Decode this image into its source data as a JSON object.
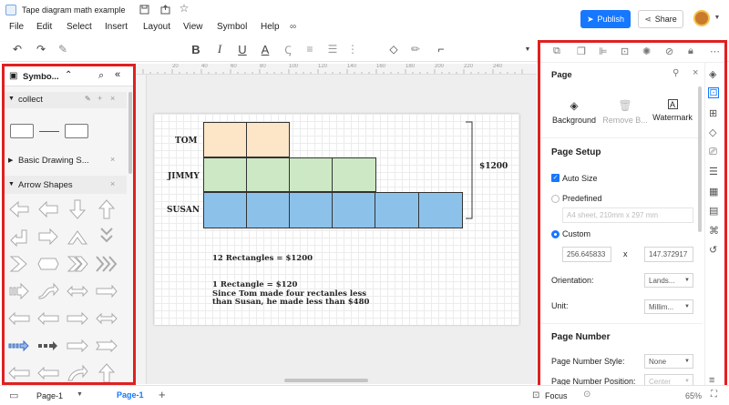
{
  "window": {
    "title": "Tape diagram math example"
  },
  "header": {
    "publish_label": "Publish",
    "share_label": "Share"
  },
  "menu": [
    "File",
    "Edit",
    "Select",
    "Insert",
    "Layout",
    "View",
    "Symbol",
    "Help"
  ],
  "toolbar": {
    "font": "Arial",
    "font_size": "12"
  },
  "left_panel": {
    "title": "Symbo...",
    "sections": {
      "collect": "collect",
      "basic": "Basic Drawing S...",
      "arrows": "Arrow Shapes"
    }
  },
  "diagram": {
    "rows": [
      {
        "label": "TOM",
        "cells": 2,
        "color": "#fde5c8"
      },
      {
        "label": "JIMMY",
        "cells": 4,
        "color": "#cde8c5"
      },
      {
        "label": "SUSAN",
        "cells": 6,
        "color": "#8cc2ea"
      }
    ],
    "total": "$1200",
    "note1": "12 Rectangles = $1200",
    "note2": "1 Rectangle = $120",
    "note3": "Since Tom made four rectanles less",
    "note4": "than Susan, he made less than $480"
  },
  "right_panel": {
    "title": "Page",
    "tabs": {
      "background": "Background",
      "remove": "Remove B...",
      "watermark": "Watermark"
    },
    "page_setup": "Page Setup",
    "auto_size": "Auto Size",
    "predefined": "Predefined",
    "predefined_value": "A4 sheet, 210mm x 297 mm",
    "custom": "Custom",
    "width": "256.645833",
    "height": "147.372917",
    "x": "x",
    "orientation_label": "Orientation:",
    "orientation_value": "Lands...",
    "unit_label": "Unit:",
    "unit_value": "Millim...",
    "page_number": "Page Number",
    "page_number_style_label": "Page Number Style:",
    "page_number_style_value": "None",
    "page_number_position_label": "Page Number Position:",
    "page_number_position_value": "Center"
  },
  "status": {
    "page_selector": "Page-1",
    "active_tab": "Page-1",
    "focus": "Focus",
    "zoom": "65%"
  },
  "ruler": [
    "20",
    "40",
    "60",
    "80",
    "100",
    "120",
    "140",
    "160",
    "180",
    "200",
    "220",
    "240"
  ],
  "colors": {
    "accent": "#1677ff",
    "highlight": "#e02020"
  }
}
